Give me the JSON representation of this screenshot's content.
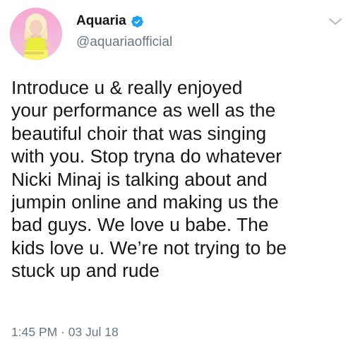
{
  "user": {
    "display_name": "Aquaria",
    "handle": "@aquariaofficial",
    "verified": true,
    "avatar_icon": "profile-photo-avatar"
  },
  "tweet": {
    "text": "Introduce u & really enjoyed\nyour performance as well as the\nbeautiful choir that was singing\nwith you. Stop tryna do whatever\nNicki Minaj is talking about and\njumpin online and making us the\nbad guys. We love u babe. The\nkids love u. We’re not trying to be\nstuck up and rude",
    "timestamp": "1:45 PM · 03 Jul 18"
  },
  "icons": {
    "verified": "verified-badge-icon",
    "menu": "chevron-down-icon"
  },
  "colors": {
    "verified_blue": "#1da1f2",
    "text_primary": "#14171a",
    "text_secondary": "#657786",
    "caret_gray": "#aab8c2"
  }
}
